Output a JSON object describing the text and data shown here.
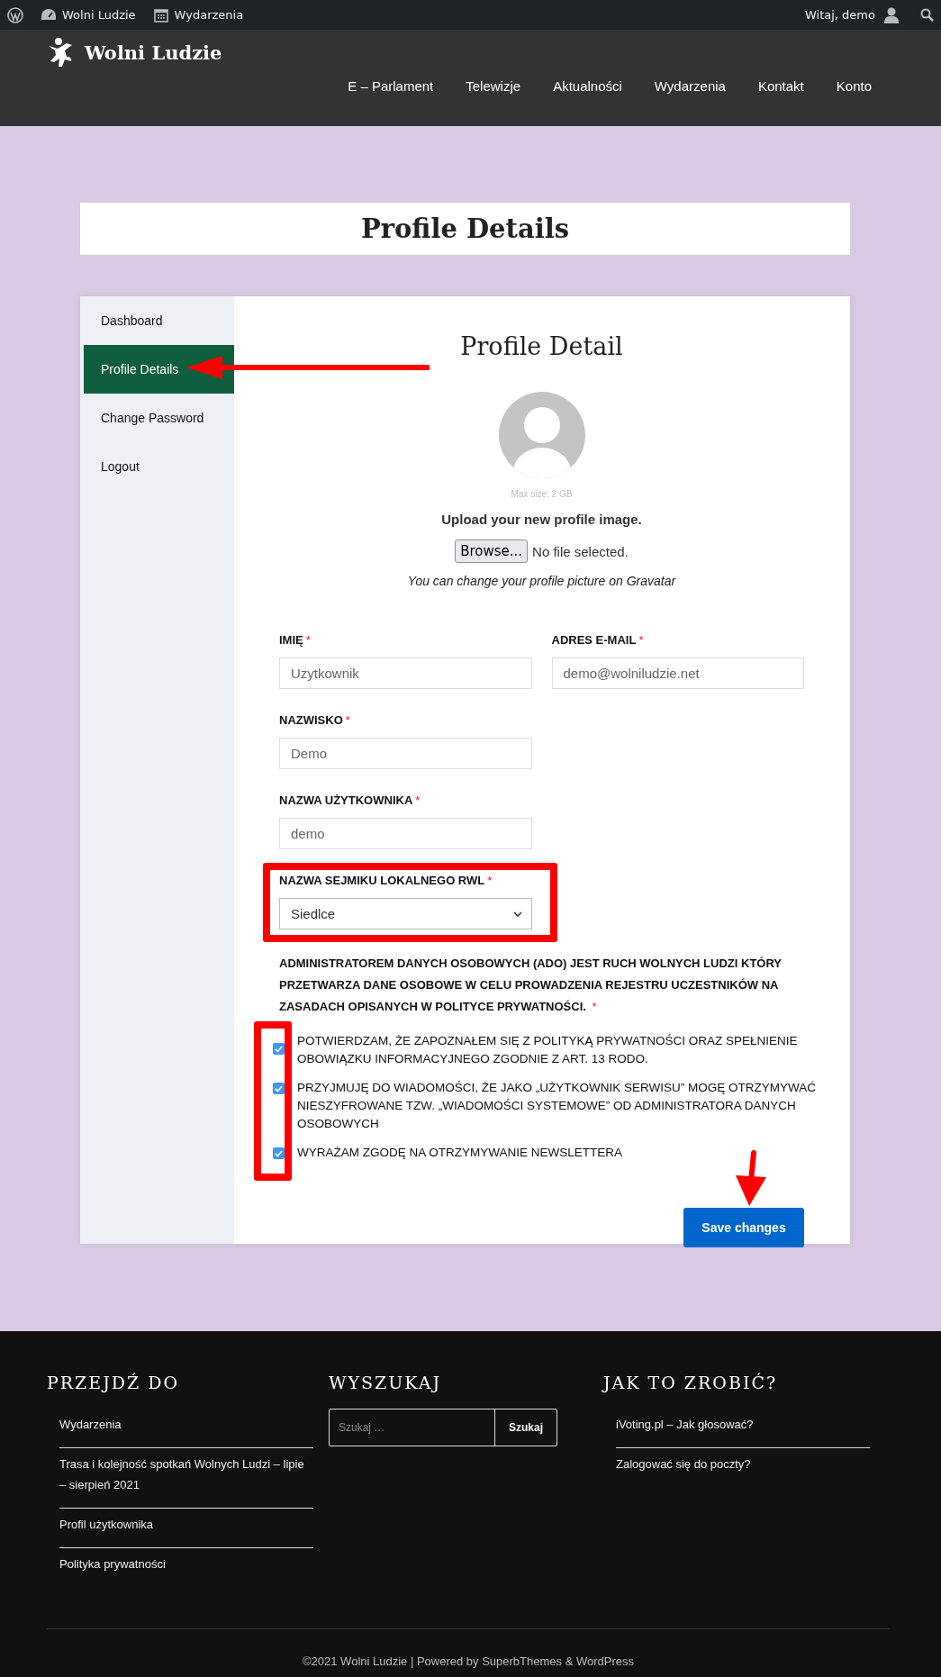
{
  "admin_bar": {
    "items": [
      {
        "kind": "site",
        "label": "Wolni Ludzie"
      },
      {
        "kind": "events",
        "label": "Wydarzenia"
      }
    ],
    "greeting": "Witaj, demo"
  },
  "header": {
    "site_name": "Wolni Ludzie",
    "nav": [
      "E – Parlament",
      "Telewizje",
      "Aktualności",
      "Wydarzenia",
      "Kontakt",
      "Konto"
    ]
  },
  "page_title": "Profile Details",
  "sidebar": {
    "items": [
      {
        "label": "Dashboard",
        "selected": false
      },
      {
        "label": "Profile Details",
        "selected": true
      },
      {
        "label": "Change Password",
        "selected": false
      },
      {
        "label": "Logout",
        "selected": false
      }
    ]
  },
  "profile": {
    "heading": "Profile Detail",
    "max_size": "Max size: 2 GB",
    "upload_label": "Upload your new profile image.",
    "browse_button": "Browse...",
    "file_status": "No file selected.",
    "gravatar_note": "You can change your profile picture on Gravatar"
  },
  "fields": [
    {
      "kind": "text",
      "label": "IMIĘ",
      "required_mark": "*",
      "value": "Uzytkownik"
    },
    {
      "kind": "text",
      "label": "ADRES E-MAIL",
      "required_mark": "*",
      "value": "demo@wolniludzie.net"
    },
    {
      "kind": "text",
      "label": "NAZWISKO",
      "required_mark": "*",
      "value": "Demo"
    },
    {
      "kind": "text",
      "label": "NAZWA UŻYTKOWNIKA",
      "required_mark": "*",
      "value": "demo"
    },
    {
      "kind": "select",
      "label": "NAZWA SEJMIKU LOKALNEGO RWL",
      "required_mark": "*",
      "value": "Siedlce"
    }
  ],
  "consent": {
    "text": "ADMINISTRATOREM DANYCH OSOBOWYCH (ADO) JEST RUCH WOLNYCH LUDZI KTÓRY PRZETWARZA DANE OSOBOWE W CELU PROWADZENIA REJESTRU UCZESTNIKÓW NA ZASADACH OPISANYCH W POLITYCE PRYWATNOŚCI.",
    "required_mark": "*"
  },
  "checkboxes": [
    {
      "label": "POTWIERDZAM, ŻE ZAPOZNAŁEM SIĘ Z POLITYKĄ PRYWATNOŚCI ORAZ SPEŁNIENIE OBOWIĄZKU INFORMACYJNEGO ZGODNIE Z ART. 13 RODO.",
      "checked": true
    },
    {
      "label": "PRZYJMUJĘ DO WIADOMOŚCI, ŻE JAKO „UŻYTKOWNIK SERWISU” MOGĘ OTRZYMYWAĆ NIESZYFROWANE TZW. „WIADOMOŚCI SYSTEMOWE” OD ADMINISTRATORA DANYCH OSOBOWYCH",
      "checked": true
    },
    {
      "label": "WYRAŻAM ZGODĘ NA OTRZYMYWANIE NEWSLETTERA",
      "checked": true
    }
  ],
  "save_button": "Save changes",
  "footer": {
    "columns": [
      {
        "kind": "links",
        "title": "PRZEJDŹ DO",
        "links": [
          "Wydarzenia",
          "Trasa i kolejność spotkań Wolnych Ludzi – lipie – sierpień 2021",
          "Profil użytkownika",
          "Polityka prywatności"
        ]
      },
      {
        "kind": "search",
        "title": "WYSZUKAJ",
        "placeholder": "Szukaj …",
        "button": "Szukaj"
      },
      {
        "kind": "links",
        "title": "JAK TO ZROBIĆ?",
        "links": [
          "iVoting.pl – Jak głosować?",
          "Zalogować się do poczty?"
        ]
      }
    ],
    "copyright": "©2021 Wolni Ludzie | Powered by SuperbThemes & WordPress"
  }
}
